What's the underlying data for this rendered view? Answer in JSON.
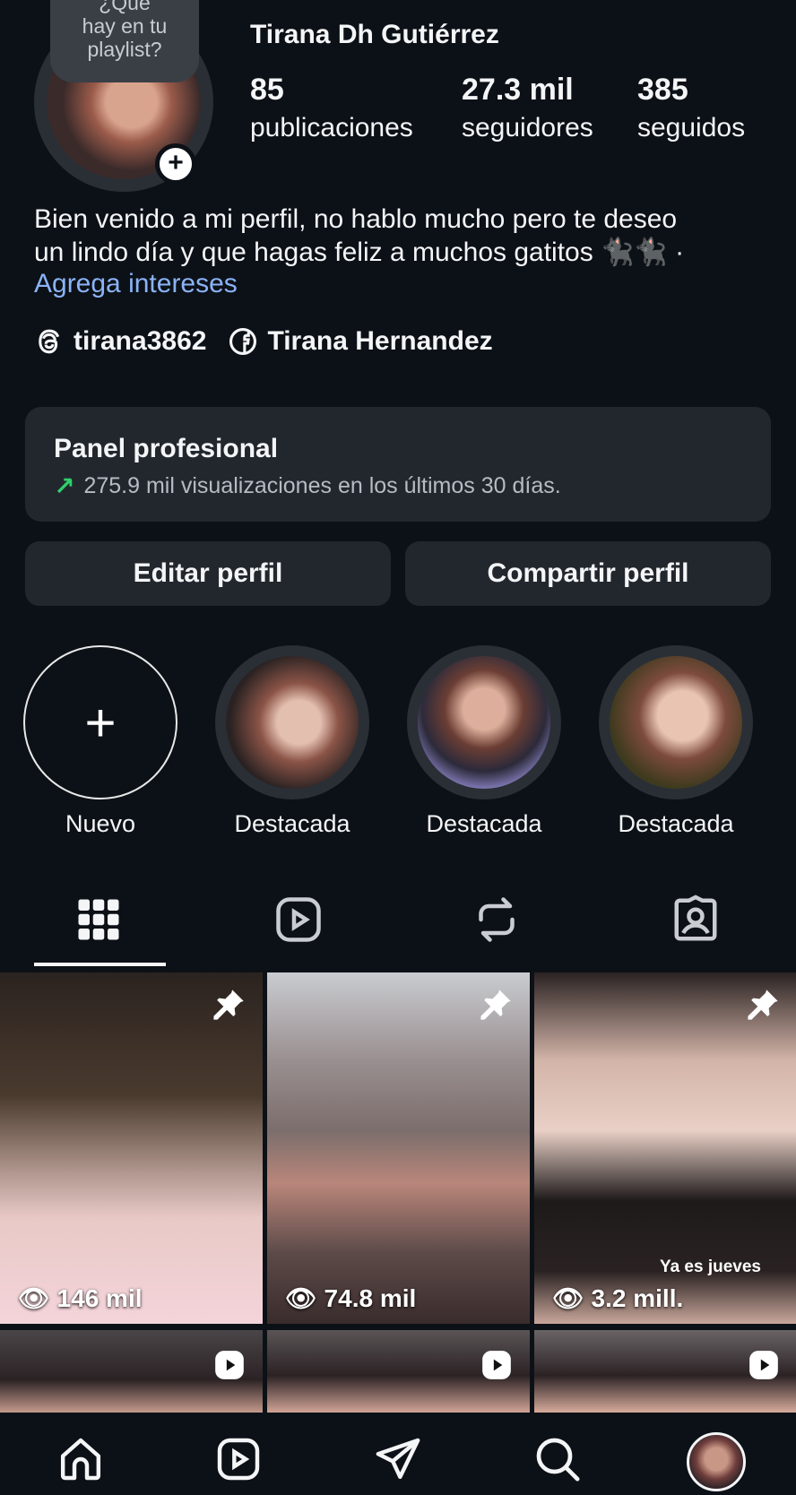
{
  "profile": {
    "note": [
      "¿Qué",
      "hay en tu",
      "playlist?"
    ],
    "name": "Tirana Dh Gutiérrez",
    "stats": [
      {
        "value": "85",
        "label": "publicaciones"
      },
      {
        "value": "27.3 mil",
        "label": "seguidores"
      },
      {
        "value": "385",
        "label": "seguidos"
      }
    ],
    "bio_line1": "Bien venido a mi perfil, no hablo mucho pero te deseo",
    "bio_line2": "un lindo día y que hagas feliz a muchos gatitos  🐈‍⬛🐈‍⬛ ·",
    "interests_link": "Agrega intereses",
    "threads_handle": "tirana3862",
    "facebook_name": "Tirana Hernandez"
  },
  "panel": {
    "title": "Panel profesional",
    "subtitle": "275.9 mil visualizaciones en los últimos 30 días.",
    "accent_color": "#2fd06b"
  },
  "buttons": {
    "edit": "Editar perfil",
    "share": "Compartir perfil"
  },
  "highlights": [
    {
      "label": "Nuevo"
    },
    {
      "label": "Destacada"
    },
    {
      "label": "Destacada"
    },
    {
      "label": "Destacada"
    }
  ],
  "tabs": [
    {
      "icon": "grid-icon"
    },
    {
      "icon": "reels-icon"
    },
    {
      "icon": "reposts-icon"
    },
    {
      "icon": "tagged-icon"
    }
  ],
  "posts": [
    {
      "views": "146 mil",
      "pinned": true
    },
    {
      "views": "74.8 mil",
      "pinned": true
    },
    {
      "views": "3.2 mill.",
      "pinned": true,
      "caption": "Ya es jueves"
    }
  ],
  "nav": [
    {
      "icon": "home-icon"
    },
    {
      "icon": "reels-icon"
    },
    {
      "icon": "send-icon"
    },
    {
      "icon": "search-icon"
    },
    {
      "icon": "profile-avatar"
    }
  ]
}
